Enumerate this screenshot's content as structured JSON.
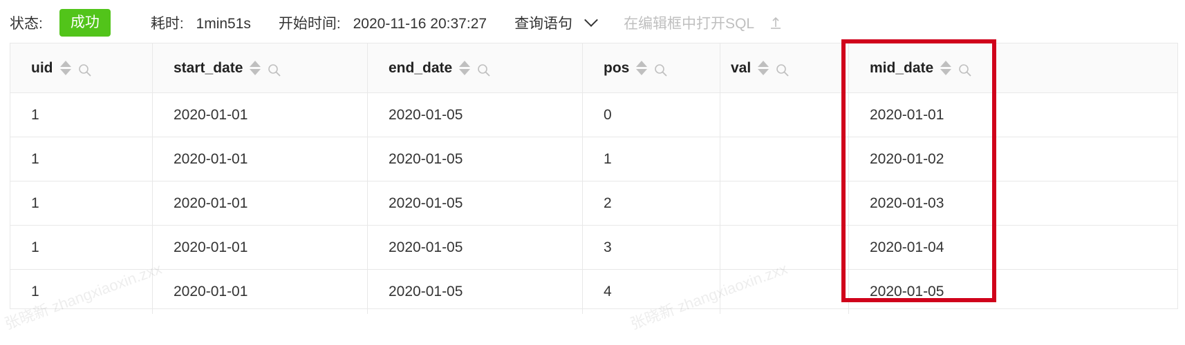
{
  "status": {
    "label": "状态:",
    "badge": "成功",
    "badge_color": "#52c41a"
  },
  "meta": {
    "duration_key": "耗时:",
    "duration_value": "1min51s",
    "start_key": "开始时间:",
    "start_value": "2020-11-16 20:37:27",
    "query_toggle": "查询语句",
    "open_editor": "在编辑框中打开SQL"
  },
  "icons": {
    "sort": "sort-arrows-icon",
    "filter": "search-icon",
    "chevron": "chevron-down-icon",
    "upload": "upload-icon"
  },
  "table": {
    "columns": [
      "uid",
      "start_date",
      "end_date",
      "pos",
      "val",
      "mid_date"
    ],
    "rows": [
      [
        "1",
        "2020-01-01",
        "2020-01-05",
        "0",
        "",
        "2020-01-01"
      ],
      [
        "1",
        "2020-01-01",
        "2020-01-05",
        "1",
        "",
        "2020-01-02"
      ],
      [
        "1",
        "2020-01-01",
        "2020-01-05",
        "2",
        "",
        "2020-01-03"
      ],
      [
        "1",
        "2020-01-01",
        "2020-01-05",
        "3",
        "",
        "2020-01-04"
      ],
      [
        "1",
        "2020-01-01",
        "2020-01-05",
        "4",
        "",
        "2020-01-05"
      ]
    ]
  },
  "highlight_color": "#d0021b",
  "watermark": "张晓新 zhangxiaoxin.zxx"
}
